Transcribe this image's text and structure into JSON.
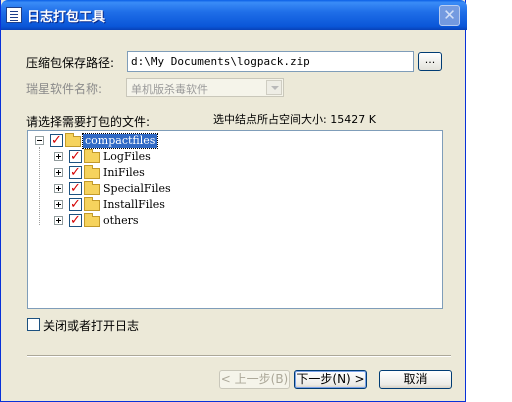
{
  "window": {
    "title": "日志打包工具",
    "close_glyph": "✕"
  },
  "form": {
    "save_path_label": "压缩包保存路径:",
    "save_path_value": "d:\\My Documents\\logpack.zip",
    "browse_label": "...",
    "software_label": "瑞星软件名称:",
    "software_value": "单机版杀毒软件",
    "select_files_label": "请选择需要打包的文件:",
    "space_label": "选中结点所占空间大小: 15427 K"
  },
  "tree": {
    "root": {
      "label": "compactfiles",
      "expander": "minus",
      "checked": true,
      "selected": true
    },
    "children": [
      {
        "label": "LogFiles",
        "expander": "plus",
        "checked": true
      },
      {
        "label": "IniFiles",
        "expander": "plus",
        "checked": true
      },
      {
        "label": "SpecialFiles",
        "expander": "plus",
        "checked": true
      },
      {
        "label": "InstallFiles",
        "expander": "plus",
        "checked": true
      },
      {
        "label": "others",
        "expander": "plus",
        "checked": true
      }
    ],
    "check_glyph": "✓"
  },
  "options": {
    "log_toggle_label": "关闭或者打开日志",
    "log_toggle_checked": false
  },
  "buttons": {
    "back": "< 上一步(B)",
    "next": "下一步(N) >",
    "cancel": "取消"
  }
}
